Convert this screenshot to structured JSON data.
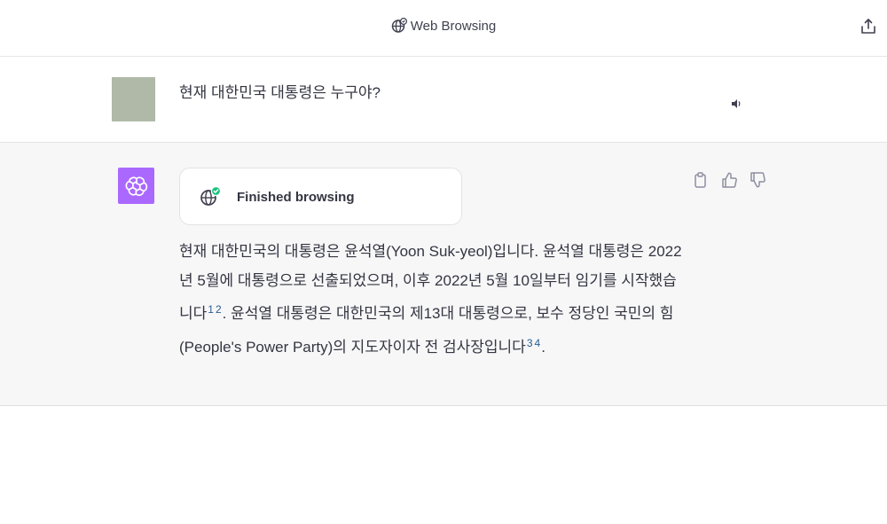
{
  "header": {
    "title": "Web Browsing",
    "icons": {
      "title": "globe-icon",
      "share": "share-icon"
    }
  },
  "user_message": {
    "text": "현재 대한민국 대통령은 누구야?",
    "avatar_color": "#b0b9a8",
    "icons": {
      "speaker": "speaker-icon"
    }
  },
  "assistant_message": {
    "avatar_color": "#ab68ff",
    "browsing_status": "Finished browsing",
    "icons": {
      "avatar": "openai-logo-icon",
      "browsing": "globe-check-icon",
      "copy": "clipboard-icon",
      "like": "thumbs-up-icon",
      "dislike": "thumbs-down-icon"
    },
    "answer": {
      "part1": "현재 대한민국의 대통령은 윤석열(Yoon Suk-yeol)입니다. 윤석열 대통령은 2022년 5월에 대통령으로 선출되었으며, 이후 2022년 5월 10일부터 임기를 시작했습니다",
      "cite1": "1",
      "cite2": "2",
      "part2": ". 윤석열 대통령은 대한민국의 제13대 대통령으로, 보수 정당인 국민의 힘(People's Power Party)의 지도자이자 전 검사장입니다",
      "cite3": "3",
      "cite4": "4",
      "part3": "."
    }
  }
}
